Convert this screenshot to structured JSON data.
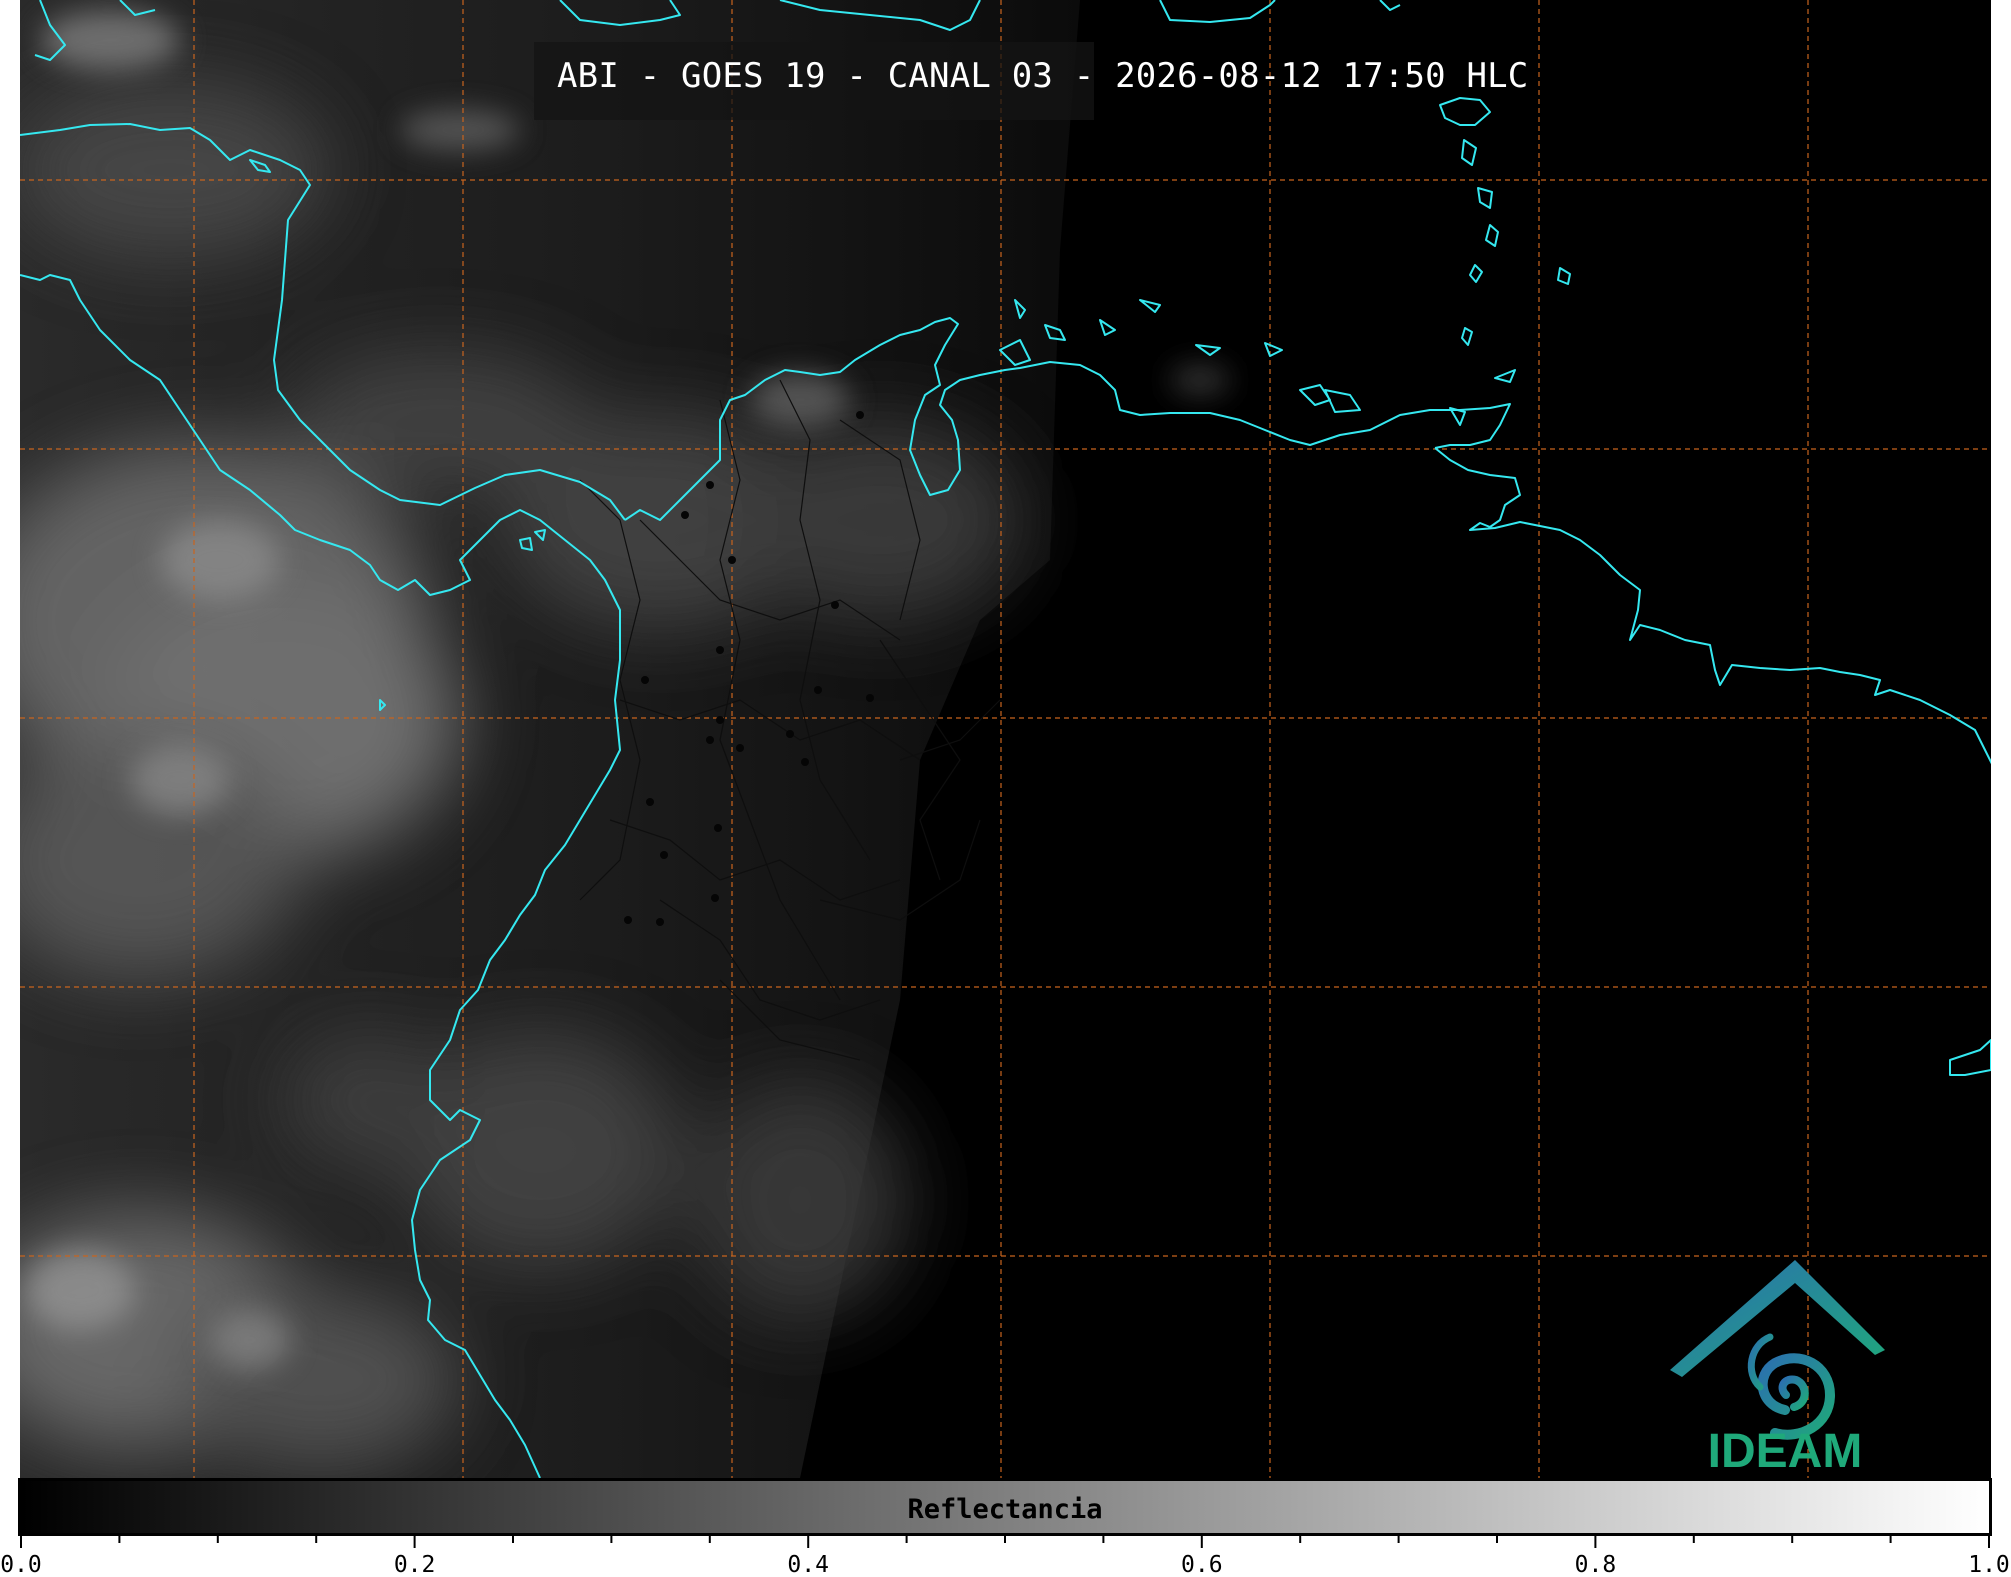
{
  "title": "ABI - GOES 19 - CANAL 03 - 2026-08-12 17:50 HLC",
  "colorbar": {
    "label": "Reflectancia",
    "ticks": [
      "0.0",
      "0.2",
      "0.4",
      "0.6",
      "0.8",
      "1.0"
    ],
    "range": [
      0.0,
      1.0
    ],
    "colormap": "grayscale"
  },
  "logo": {
    "text": "IDEAM",
    "color": "#1fa97a",
    "accent": "#2b6fb0"
  },
  "map": {
    "coastline_color": "#35e8f0",
    "graticule_color": "#c8641e",
    "border_color": "#111111"
  }
}
